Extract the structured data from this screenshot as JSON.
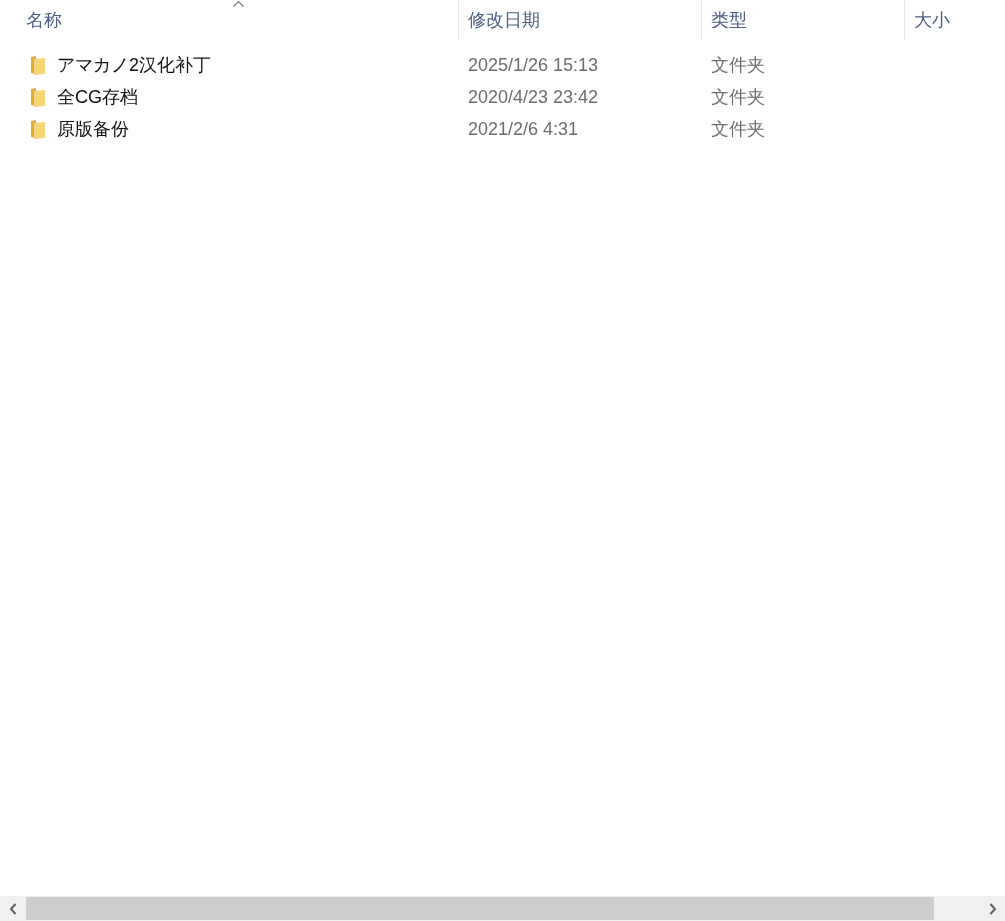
{
  "table": {
    "columns": [
      {
        "label": "名称",
        "sorted": true
      },
      {
        "label": "修改日期",
        "sorted": false
      },
      {
        "label": "类型",
        "sorted": false
      },
      {
        "label": "大小",
        "sorted": false
      }
    ],
    "rows": [
      {
        "name": "アマカノ2汉化补丁",
        "modified": "2025/1/26 15:13",
        "type": "文件夹"
      },
      {
        "name": "全CG存档",
        "modified": "2020/4/23 23:42",
        "type": "文件夹"
      },
      {
        "name": "原版备份",
        "modified": "2021/2/6 4:31",
        "type": "文件夹"
      }
    ]
  }
}
